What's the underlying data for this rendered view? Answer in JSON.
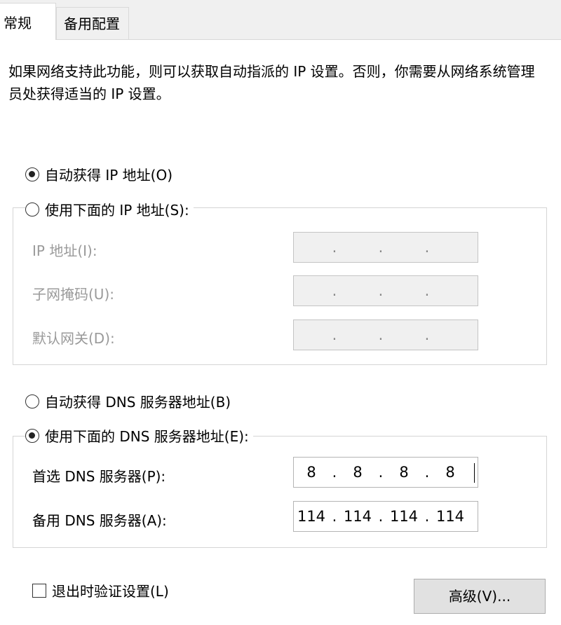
{
  "tabs": [
    {
      "label": "常规",
      "active": true
    },
    {
      "label": "备用配置",
      "active": false
    }
  ],
  "description": "如果网络支持此功能，则可以获取自动指派的 IP 设置。否则，你需要从网络系统管理员处获得适当的 IP 设置。",
  "ip_mode": {
    "auto_label": "自动获得 IP 地址(O)",
    "manual_label": "使用下面的 IP 地址(S):",
    "selected": "auto",
    "fields": [
      {
        "label": "IP 地址(I):",
        "octets": [
          "",
          "",
          "",
          ""
        ]
      },
      {
        "label": "子网掩码(U):",
        "octets": [
          "",
          "",
          "",
          ""
        ]
      },
      {
        "label": "默认网关(D):",
        "octets": [
          "",
          "",
          "",
          ""
        ]
      }
    ]
  },
  "dns_mode": {
    "auto_label": "自动获得 DNS 服务器地址(B)",
    "manual_label": "使用下面的 DNS 服务器地址(E):",
    "selected": "manual",
    "fields": [
      {
        "label": "首选 DNS 服务器(P):",
        "octets": [
          "8",
          "8",
          "8",
          "8"
        ]
      },
      {
        "label": "备用 DNS 服务器(A):",
        "octets": [
          "114",
          "114",
          "114",
          "114"
        ]
      }
    ]
  },
  "validate_checkbox": {
    "label": "退出时验证设置(L)",
    "checked": false
  },
  "advanced_button": {
    "label": "高级(V)..."
  }
}
